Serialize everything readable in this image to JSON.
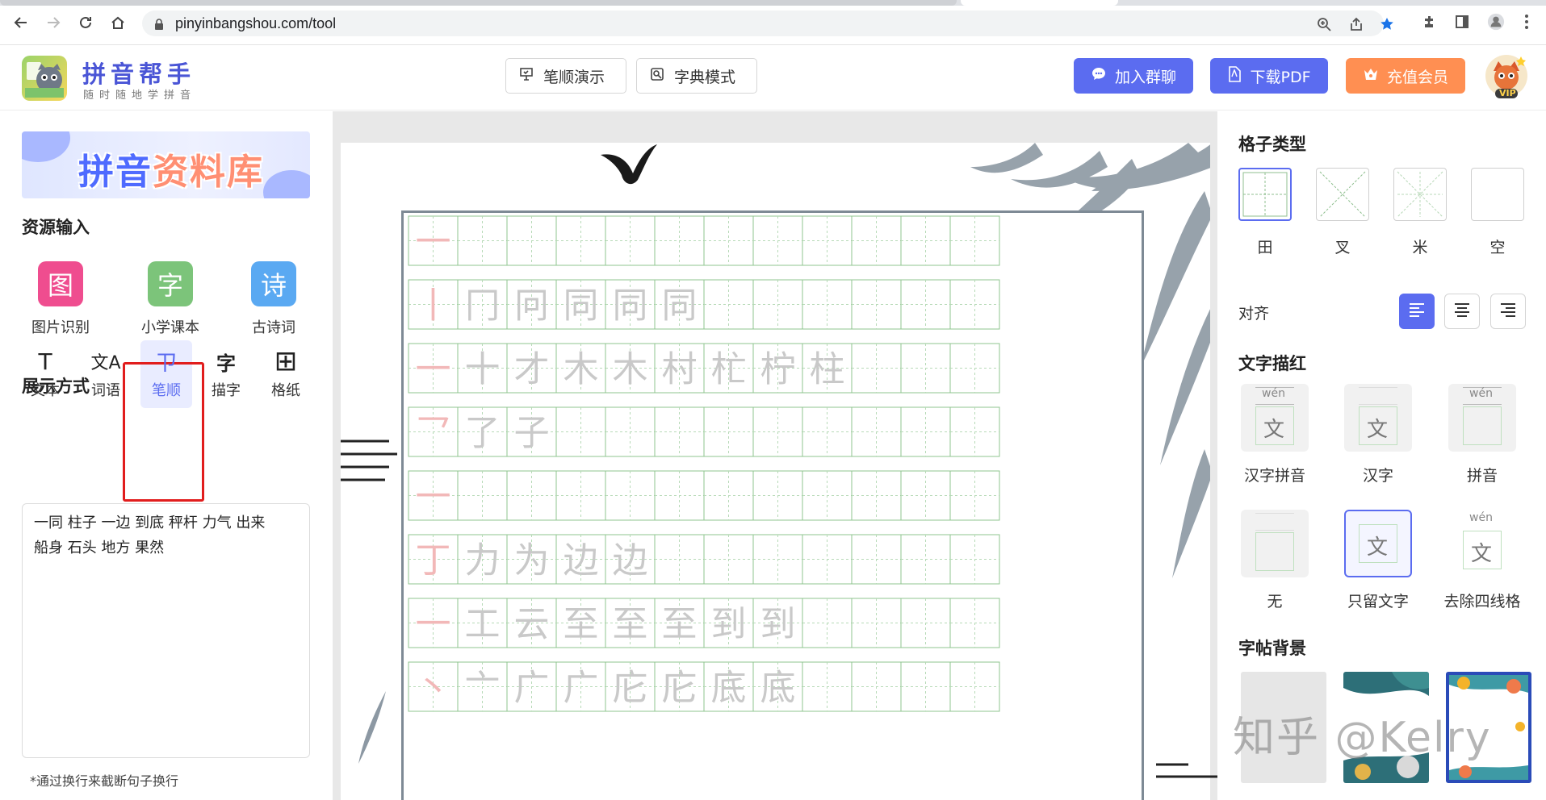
{
  "browser": {
    "url": "pinyinbangshou.com/tool"
  },
  "header": {
    "brand_title": "拼音帮手",
    "brand_subtitle": "随时随地学拼音",
    "stroke_demo_label": "笔顺演示",
    "dict_mode_label": "字典模式",
    "join_group_label": "加入群聊",
    "download_pdf_label": "下载PDF",
    "vip_label": "充值会员",
    "avatar_badge": "VIP",
    "colors": {
      "accent": "#5b6cf0",
      "vip": "#ff8f52"
    }
  },
  "left": {
    "banner_text_a": "拼音",
    "banner_text_b": "资料库",
    "resource_title": "资源输入",
    "resources": [
      {
        "glyph": "图",
        "label": "图片识别",
        "color": "#ef4d8f"
      },
      {
        "glyph": "字",
        "label": "小学课本",
        "color": "#7cc47a"
      },
      {
        "glyph": "诗",
        "label": "古诗词",
        "color": "#5aa9f2"
      }
    ],
    "display_title": "展示方式",
    "modes": [
      {
        "glyph": "T",
        "label": "文本"
      },
      {
        "glyph": "文A",
        "label": "词语"
      },
      {
        "glyph": "ㄗ",
        "label": "笔顺"
      },
      {
        "glyph": "字",
        "label": "描字"
      },
      {
        "glyph": "⊞",
        "label": "格纸"
      }
    ],
    "input_text": "一同 柱子 一边 到底 秤杆 力气 出来\n船身 石头 地方 果然",
    "note": "*通过换行来截断句子换行"
  },
  "practice": {
    "rows": [
      [
        "一"
      ],
      [
        "丨",
        "冂",
        "冋",
        "同",
        "同",
        "同"
      ],
      [
        "一",
        "十",
        "才",
        "木",
        "木",
        "村",
        "杧",
        "柠",
        "柱"
      ],
      [
        "乛",
        "了",
        "子"
      ],
      [
        "一"
      ],
      [
        "丁",
        "力",
        "为",
        "边",
        "边"
      ],
      [
        "一",
        "工",
        "云",
        "至",
        "至",
        "至",
        "到",
        "到"
      ],
      [
        "丶",
        "亠",
        "广",
        "广",
        "庀",
        "庀",
        "底",
        "底"
      ]
    ]
  },
  "right": {
    "grid_type_title": "格子类型",
    "grid_types": [
      "田",
      "叉",
      "米",
      "空"
    ],
    "align_label": "对齐",
    "trace_title": "文字描红",
    "trace_options": [
      "汉字拼音",
      "汉字",
      "拼音",
      "无",
      "只留文字",
      "去除四线格"
    ],
    "trace_pinyin": "wén",
    "trace_char": "文",
    "bg_title": "字帖背景"
  },
  "watermark": "知乎 @Kelry"
}
